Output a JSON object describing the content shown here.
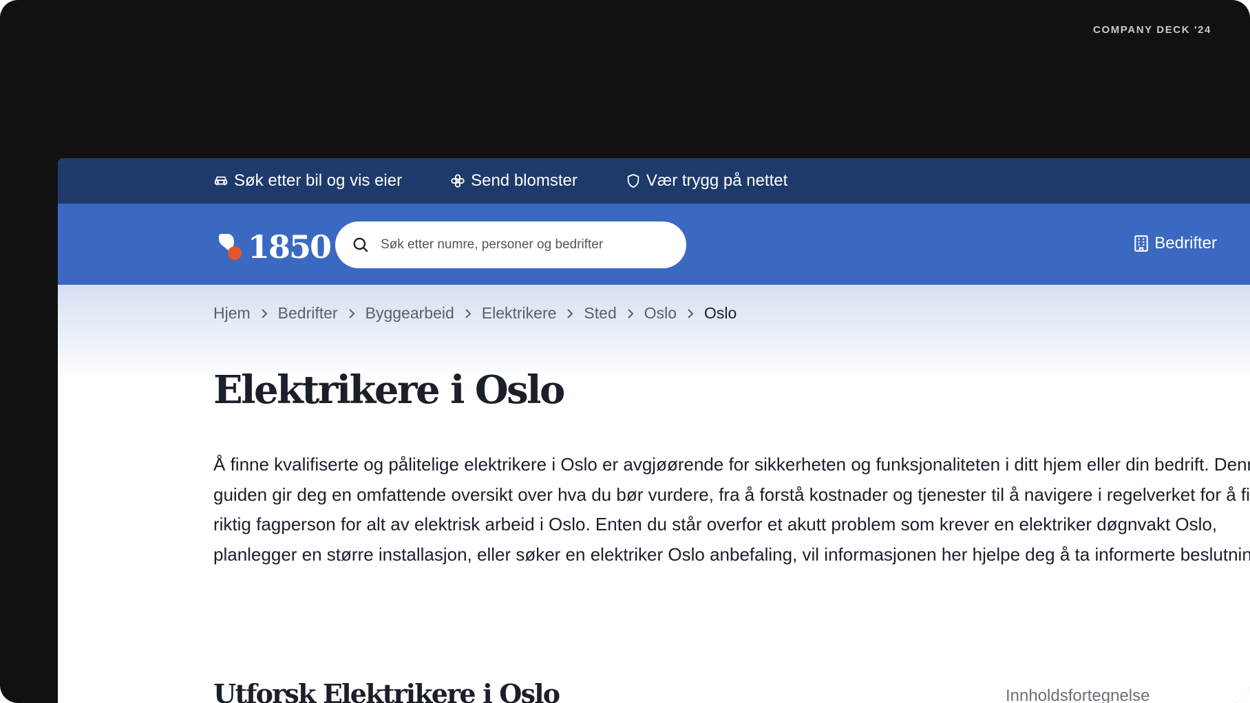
{
  "deck_label": "COMPANY DECK '24",
  "topbar": {
    "items": [
      {
        "label": "Søk etter bil og vis eier",
        "icon": "car-icon"
      },
      {
        "label": "Send blomster",
        "icon": "flower-icon"
      },
      {
        "label": "Vær trygg på nettet",
        "icon": "shield-icon"
      }
    ]
  },
  "header": {
    "logo_text": "1850",
    "search": {
      "placeholder": "Søk etter numre, personer og bedrifter",
      "value": ""
    },
    "right_link": "Bedrifter"
  },
  "breadcrumb": [
    "Hjem",
    "Bedrifter",
    "Byggearbeid",
    "Elektrikere",
    "Sted",
    "Oslo",
    "Oslo"
  ],
  "page": {
    "title": "Elektrikere i Oslo",
    "intro": "Å finne kvalifiserte og pålitelige elektrikere i Oslo er avgjøørende for sikkerheten og funksjonaliteten i ditt hjem eller din bedrift. Denne guiden gir deg en omfattende oversikt over hva du bør vurdere, fra å forstå kostnader og tjenester til å navigere i regelverket for å finne riktig fagperson for alt av elektrisk arbeid i Oslo. Enten du står overfor et akutt problem som krever en elektriker døgnvakt Oslo, planlegger en større installasjon, eller søker en elektriker Oslo anbefaling, vil informasjonen her hjelpe deg å ta informerte beslutninger.",
    "subtitle": "Utforsk Elektrikere i Oslo",
    "toc_label": "Innholdsfortegnelse"
  },
  "colors": {
    "topbar_bg": "#1e3a6b",
    "header_bg": "#3b69c1",
    "logo_accent": "#e0562c",
    "frame_bg": "#111111"
  }
}
